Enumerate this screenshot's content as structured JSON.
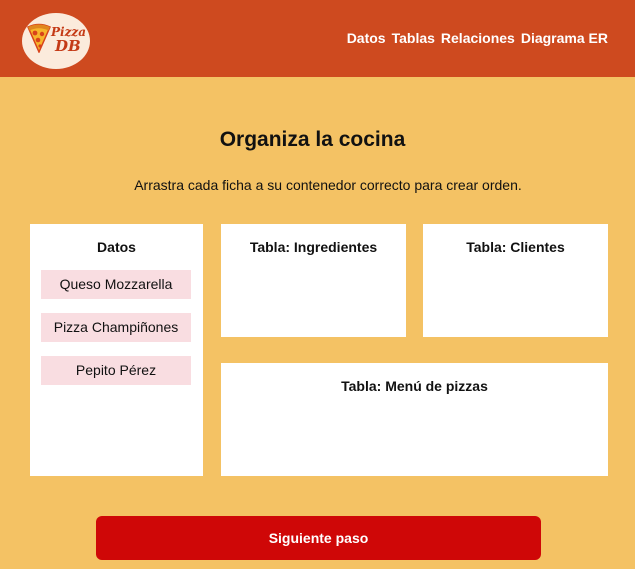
{
  "header": {
    "logo": {
      "line1": "Pizza",
      "line2": "DB"
    },
    "nav": [
      "Datos",
      "Tablas",
      "Relaciones",
      "Diagrama ER"
    ]
  },
  "main": {
    "title": "Organiza la cocina",
    "subtitle": "Arrastra cada ficha a su contenedor correcto para crear orden."
  },
  "datos_panel": {
    "heading": "Datos",
    "items": [
      "Queso Mozzarella",
      "Pizza Champiñones",
      "Pepito Pérez"
    ]
  },
  "drop_zones": {
    "ingredientes": "Tabla: Ingredientes",
    "clientes": "Tabla: Clientes",
    "menu": "Tabla: Menú de pizzas"
  },
  "footer": {
    "next_label": "Siguiente paso"
  },
  "colors": {
    "header_bg": "#CE4A1F",
    "page_bg": "#F4C264",
    "chip_bg": "#F9DDE1",
    "button_bg": "#CF0707"
  }
}
